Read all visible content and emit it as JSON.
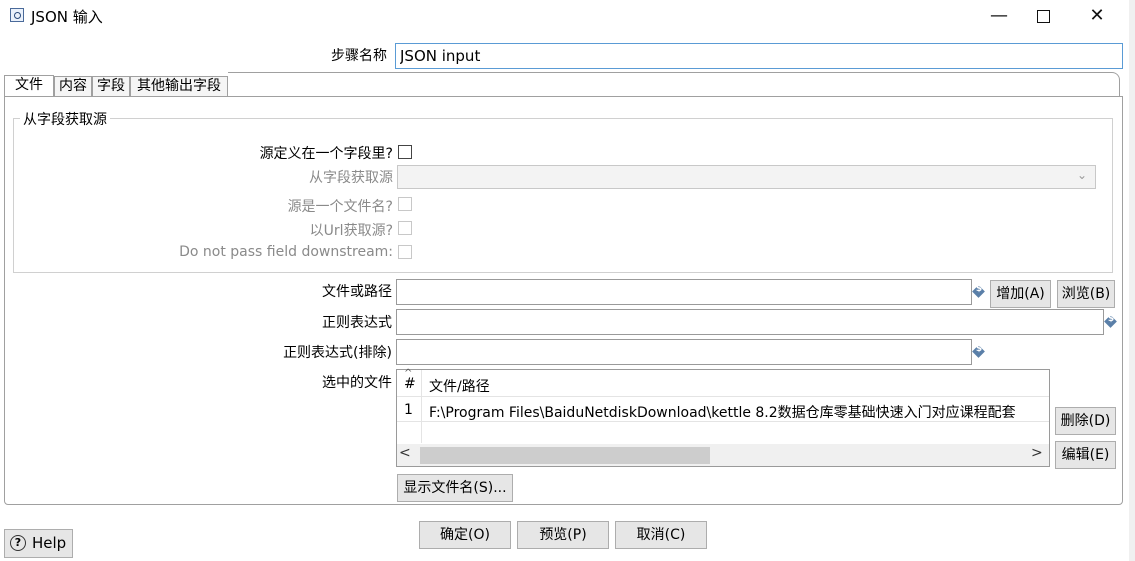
{
  "window": {
    "title": "JSON 输入",
    "minimize": "—",
    "close": "✕"
  },
  "step_name": {
    "label": "步骤名称",
    "value": "JSON input"
  },
  "tabs": [
    {
      "label": "文件"
    },
    {
      "label": "内容"
    },
    {
      "label": "字段"
    },
    {
      "label": "其他输出字段"
    }
  ],
  "source_group": {
    "title": "从字段获取源",
    "source_in_field_label": "源定义在一个字段里?",
    "get_source_from_field_label": "从字段获取源",
    "source_is_filename_label": "源是一个文件名?",
    "read_url_label": "以Url获取源?",
    "do_not_pass_label": "Do not pass field downstream:"
  },
  "file_section": {
    "file_or_dir_label": "文件或路径",
    "file_or_dir_value": "",
    "add_button": "增加(A)",
    "browse_button": "浏览(B)",
    "regex_label": "正则表达式",
    "regex_value": "",
    "exclude_regex_label": "正则表达式(排除)",
    "exclude_regex_value": "",
    "selected_files_label": "选中的文件",
    "table": {
      "columns": [
        "#",
        "文件/路径"
      ],
      "rows": [
        {
          "num": "1",
          "path": "F:\\Program Files\\BaiduNetdiskDownload\\kettle 8.2数据仓库零基础快速入门对应课程配套"
        }
      ]
    },
    "delete_button": "删除(D)",
    "edit_button": "编辑(E)",
    "show_filenames_button": "显示文件名(S)..."
  },
  "footer": {
    "help": "Help",
    "ok": "确定(O)",
    "preview": "预览(P)",
    "cancel": "取消(C)"
  },
  "icons": {
    "app": "json-input-icon",
    "variable": "variable-dollar-icon",
    "help": "help-icon"
  },
  "colors": {
    "focus_border": "#5a9bd5",
    "button_bg": "#e6e6e6",
    "disabled_text": "#8a8a8a"
  }
}
